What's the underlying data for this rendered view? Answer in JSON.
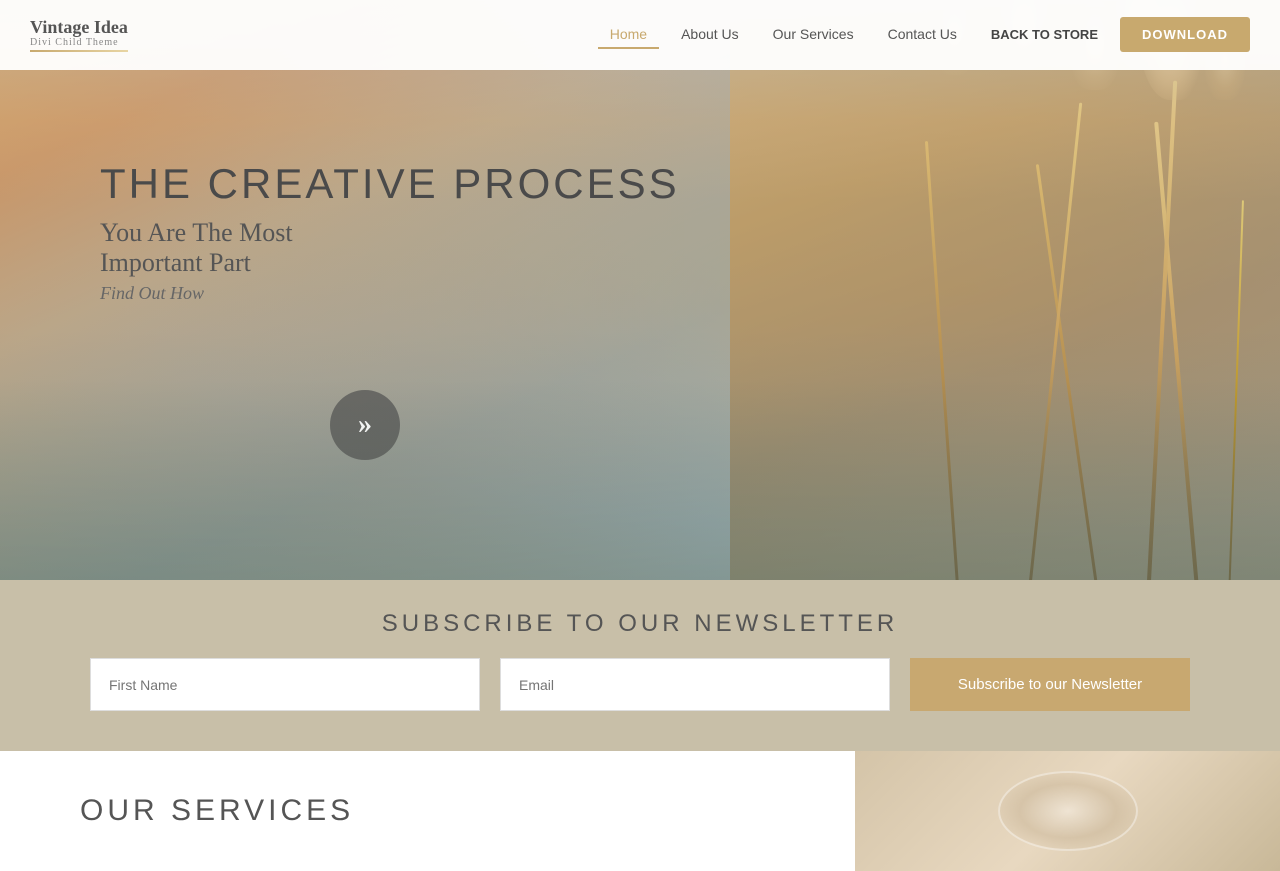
{
  "logo": {
    "title": "Vintage Idea",
    "subtitle": "Divi Child Theme"
  },
  "nav": {
    "links": [
      {
        "label": "Home",
        "active": true
      },
      {
        "label": "About Us",
        "active": false
      },
      {
        "label": "Our Services",
        "active": false
      },
      {
        "label": "Contact Us",
        "active": false
      },
      {
        "label": "BACK TO STORE",
        "active": false,
        "style": "back-store"
      },
      {
        "label": "DOWNLOAD",
        "active": false,
        "style": "download"
      }
    ]
  },
  "hero": {
    "title": "THE CREATIVE PROCESS",
    "subtitle": "You Are The Most",
    "subtitle2": "Important Part",
    "tagline": "Find Out How",
    "arrow": "»"
  },
  "newsletter": {
    "title": "SUBSCRIBE TO OUR NEWSLETTER",
    "firstname_placeholder": "First Name",
    "email_placeholder": "Email",
    "button_label": "Subscribe to our Newsletter"
  },
  "services": {
    "title": "OUR SERVICES"
  }
}
